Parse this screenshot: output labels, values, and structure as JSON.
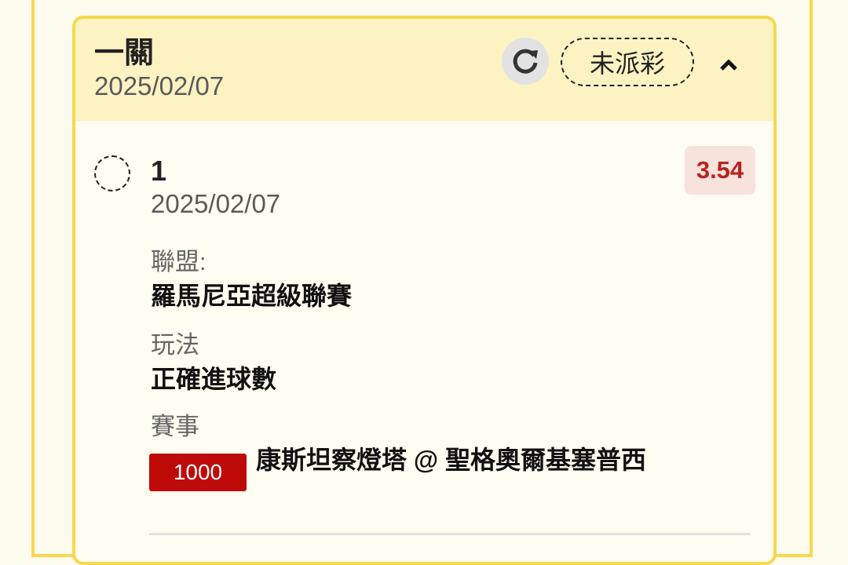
{
  "card": {
    "bet_type": "一關",
    "date": "2025/02/07",
    "status": "未派彩",
    "refresh_icon": "refresh-icon",
    "collapse_icon": "chevron-up-icon"
  },
  "leg": {
    "number": "1",
    "date": "2025/02/07",
    "odds": "3.54",
    "league_label": "聯盟:",
    "league_value": "羅馬尼亞超級聯賽",
    "pool_label": "玩法",
    "pool_value": "正確進球數",
    "match_label": "賽事",
    "match_no": "1000",
    "match_name": "康斯坦察燈塔 @ 聖格奧爾基塞普西"
  },
  "colors": {
    "card_border": "#f7d84a",
    "header_bg": "#fdf2c2",
    "odds_text": "#b52421",
    "match_badge": "#bf0a0a"
  }
}
